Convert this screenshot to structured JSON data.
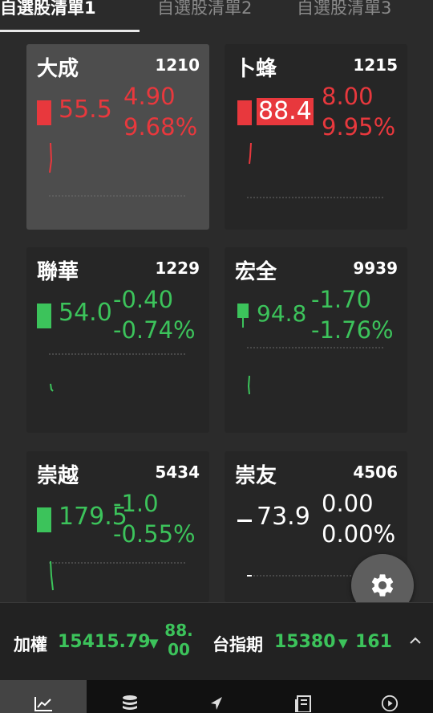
{
  "tabs": [
    {
      "label": "自選股清單1",
      "active": true
    },
    {
      "label": "自選股清單2",
      "active": false
    },
    {
      "label": "自選股清單3",
      "active": false
    }
  ],
  "cards": [
    {
      "name": "大成",
      "code": "1210",
      "price": "55.5",
      "change": "4.90",
      "percent": "9.68%",
      "direction": "up"
    },
    {
      "name": "卜蜂",
      "code": "1215",
      "price": "88.4",
      "change": "8.00",
      "percent": "9.95%",
      "direction": "up-limit"
    },
    {
      "name": "聯華",
      "code": "1229",
      "price": "54.0",
      "change": "-0.40",
      "percent": "-0.74%",
      "direction": "down"
    },
    {
      "name": "宏全",
      "code": "9939",
      "price": "94.8",
      "change": "-1.70",
      "percent": "-1.76%",
      "direction": "down"
    },
    {
      "name": "崇越",
      "code": "5434",
      "price": "179.5",
      "change": "-1.0",
      "percent": "-0.55%",
      "direction": "down"
    },
    {
      "name": "崇友",
      "code": "4506",
      "price": "73.9",
      "change": "0.00",
      "percent": "0.00%",
      "direction": "flat"
    }
  ],
  "ticker": {
    "taiex": {
      "label": "加權",
      "value": "15415.79",
      "change_top": "88.",
      "change_bottom": "00"
    },
    "futures": {
      "label": "台指期",
      "value": "15380",
      "change": "161"
    }
  },
  "colors": {
    "up": "#e8383d",
    "down": "#3cc35b",
    "flat": "#ffffff",
    "background": "#2b2b2b"
  },
  "icons": {
    "settings": "gear-icon",
    "nav": [
      "line-chart-icon",
      "database-icon",
      "navigation-arrow-icon",
      "news-icon",
      "play-circle-icon"
    ],
    "expand": "chevron-up-icon"
  }
}
